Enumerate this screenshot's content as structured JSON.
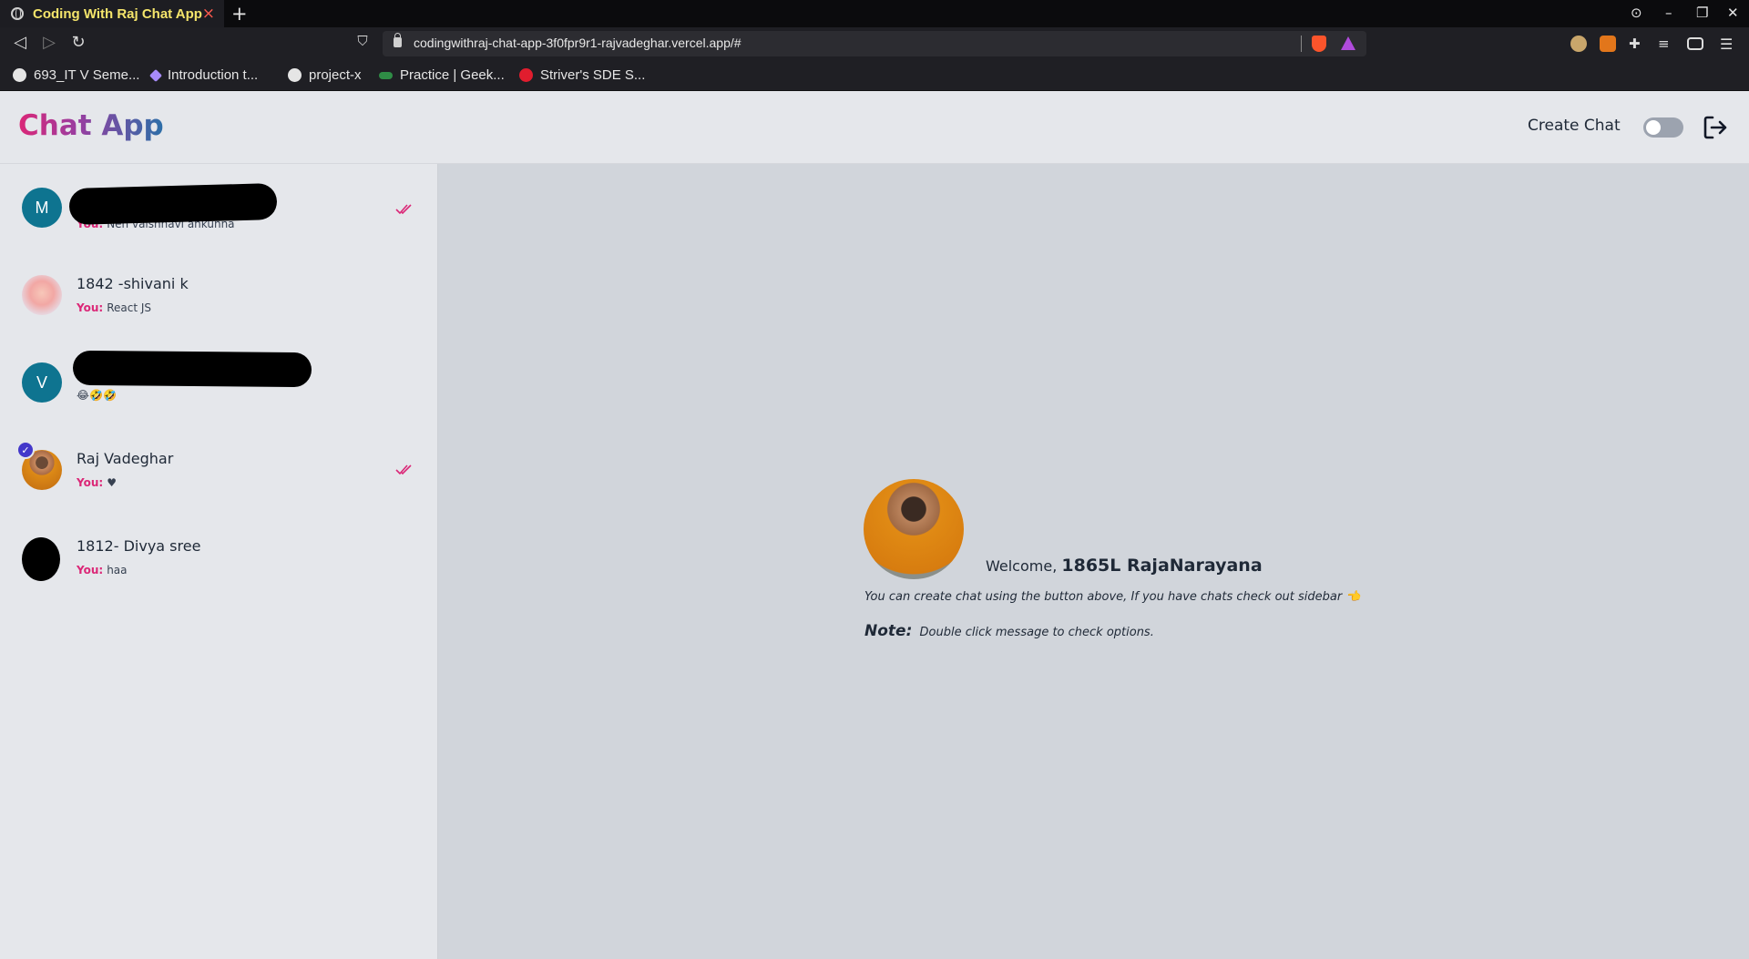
{
  "browser": {
    "tab_title": "Coding With Raj Chat App",
    "tab_close": "×",
    "new_tab": "+",
    "url": "codingwithraj-chat-app-3f0fpr9r1-rajvadeghar.vercel.app/#",
    "bookmarks": [
      {
        "label": "693_IT V Seme...",
        "icon": "globe-icon",
        "color": "#e5e5e5"
      },
      {
        "label": "Introduction t...",
        "icon": "ethereum-icon",
        "color": "#a78bfa"
      },
      {
        "label": "project-x",
        "icon": "github-icon",
        "color": "#e5e5e5"
      },
      {
        "label": "Practice | Geek...",
        "icon": "geeksforgeeks-icon",
        "color": "#2f8d46"
      },
      {
        "label": "Striver's SDE S...",
        "icon": "takeuforward-icon",
        "color": "#e11d2e"
      }
    ]
  },
  "app": {
    "logo": "Chat App",
    "create_chat": "Create Chat",
    "dark_mode_on": false,
    "accent": "#db2777"
  },
  "chats": [
    {
      "name": "",
      "preview": "Nen vaishnavi ankunna",
      "you": "You:",
      "avatar_letter": "M",
      "seen": true
    },
    {
      "name": "1842 -shivani k",
      "preview": "React JS",
      "you": "You:",
      "avatar_letter": "",
      "seen": false
    },
    {
      "name": "",
      "preview": "😂🤣🤣",
      "you": "",
      "avatar_letter": "V",
      "seen": false
    },
    {
      "name": "Raj Vadeghar",
      "preview": "♥",
      "you": "You:",
      "avatar_letter": "",
      "seen": true,
      "verified": true
    },
    {
      "name": "1812- Divya sree",
      "preview": "haa",
      "you": "You:",
      "avatar_letter": "",
      "seen": false
    }
  ],
  "welcome": {
    "prefix": "Welcome,",
    "user": "1865L RajaNarayana",
    "hint": "You can create chat using the button above, If you have chats check out sidebar 👈",
    "note_label": "Note:",
    "note_text": "Double click message to check options."
  }
}
